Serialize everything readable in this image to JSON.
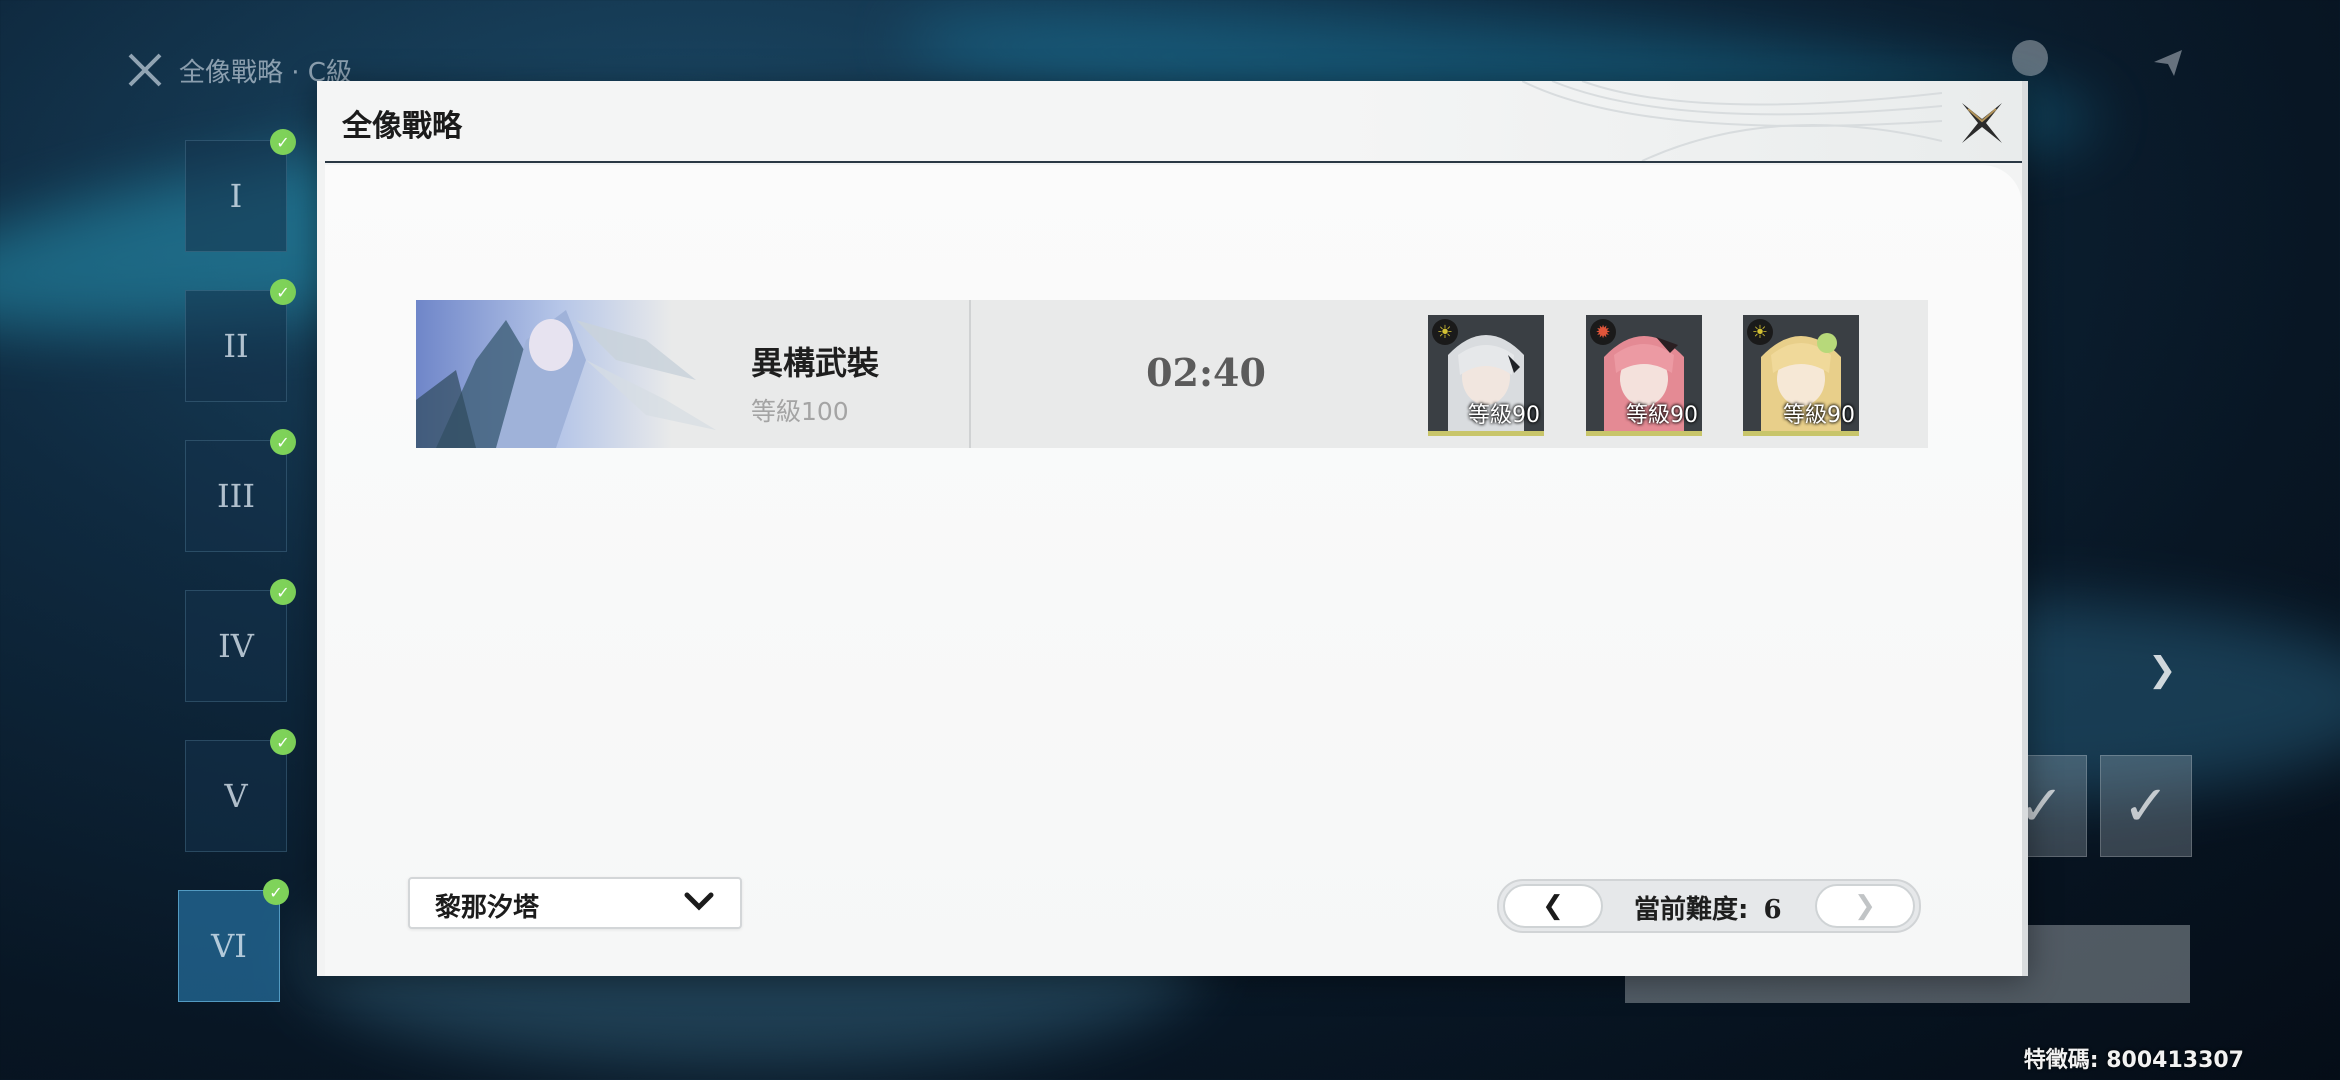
{
  "background": {
    "top_title": "全像戰略 · C級",
    "nav_items": [
      "I",
      "II",
      "III",
      "IV",
      "V",
      "VI"
    ]
  },
  "modal": {
    "title": "全像戰略",
    "record": {
      "boss_name": "異構武裝",
      "boss_level": "等級100",
      "clear_time": "02:40",
      "team": [
        {
          "level": "等級90",
          "element": "sun-icon",
          "color": "#d4c234"
        },
        {
          "level": "等級90",
          "element": "flame-icon",
          "color": "#e0553a"
        },
        {
          "level": "等級90",
          "element": "sun-icon",
          "color": "#d4c234"
        }
      ]
    },
    "character_select": {
      "value": "黎那汐塔"
    },
    "difficulty": {
      "label": "當前難度:",
      "value": "6",
      "prev": "❮",
      "next": "❯"
    }
  },
  "uid_label": "特徵碼: 800413307"
}
